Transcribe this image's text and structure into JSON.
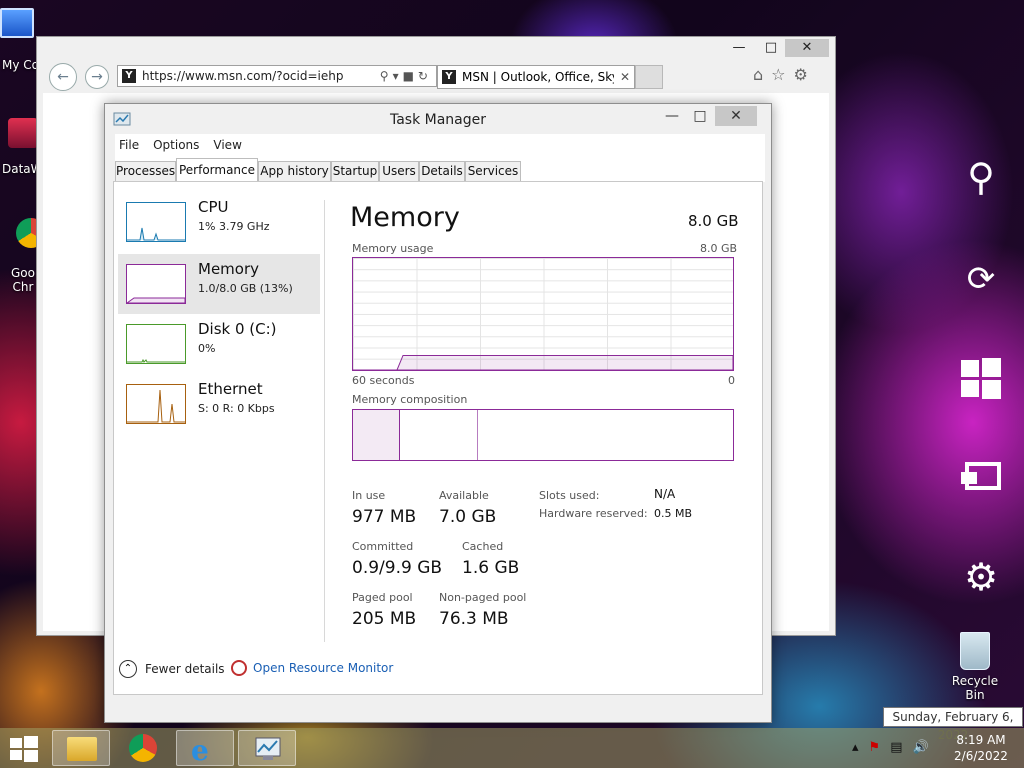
{
  "desktop": {
    "icons": [
      {
        "label": "My Co"
      },
      {
        "label": "DataW"
      },
      {
        "label": "Goo Chr"
      }
    ],
    "recycle_bin": "Recycle Bin"
  },
  "browser": {
    "url": "https://www.msn.com/?ocid=iehp",
    "tab_title": "MSN | Outlook, Office, Sky...",
    "favicon_letter": "Y"
  },
  "task_manager": {
    "title": "Task Manager",
    "menu": [
      "File",
      "Options",
      "View"
    ],
    "tabs": [
      "Processes",
      "Performance",
      "App history",
      "Startup",
      "Users",
      "Details",
      "Services"
    ],
    "active_tab": "Performance",
    "sidebar": [
      {
        "name": "CPU",
        "sub": "1% 3.79 GHz",
        "color": "#1a7ab0"
      },
      {
        "name": "Memory",
        "sub": "1.0/8.0 GB (13%)",
        "color": "#8b2a98"
      },
      {
        "name": "Disk 0 (C:)",
        "sub": "0%",
        "color": "#4a9a2a"
      },
      {
        "name": "Ethernet",
        "sub": "S: 0 R: 0 Kbps",
        "color": "#a7600f"
      }
    ],
    "memory": {
      "title": "Memory",
      "total": "8.0 GB",
      "usage_label": "Memory usage",
      "usage_max": "8.0 GB",
      "time_left": "60 seconds",
      "time_right": "0",
      "composition_label": "Memory composition",
      "usage_fraction": 0.13,
      "stats": {
        "in_use_label": "In use",
        "in_use": "977 MB",
        "available_label": "Available",
        "available": "7.0 GB",
        "committed_label": "Committed",
        "committed": "0.9/9.9 GB",
        "cached_label": "Cached",
        "cached": "1.6 GB",
        "paged_label": "Paged pool",
        "paged": "205 MB",
        "nonpaged_label": "Non-paged pool",
        "nonpaged": "76.3 MB",
        "slots_label": "Slots used:",
        "slots": "N/A",
        "hw_label": "Hardware reserved:",
        "hw": "0.5 MB"
      }
    },
    "footer": {
      "fewer_details": "Fewer details",
      "open_monitor": "Open Resource Monitor"
    }
  },
  "tooltip": "Sunday, February 6, 2022",
  "clock": {
    "time": "8:19 AM",
    "date": "2/6/2022"
  },
  "colors": {
    "accent": "#8b2a98",
    "link": "#1a5fb4"
  }
}
